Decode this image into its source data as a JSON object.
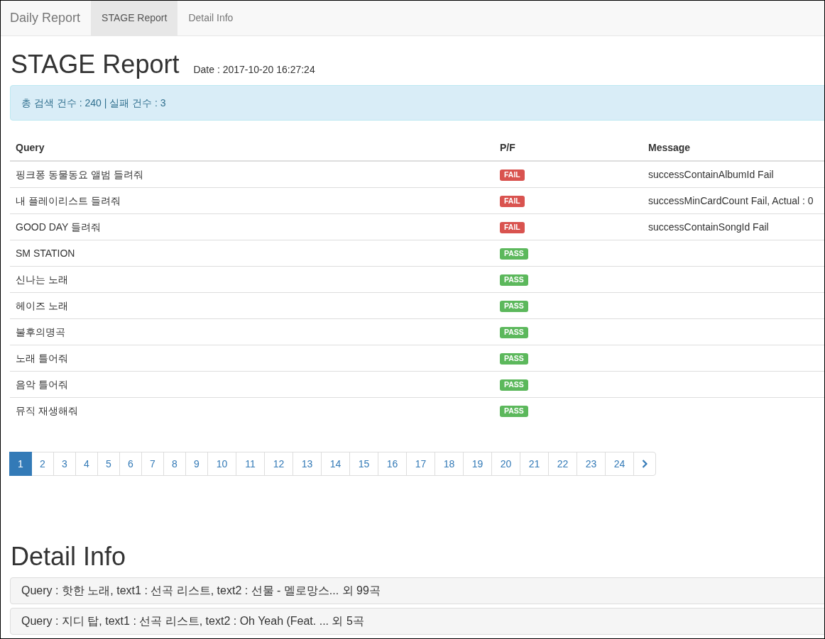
{
  "nav": {
    "brand": "Daily Report",
    "tabs": [
      {
        "label": "STAGE Report",
        "selected": true
      },
      {
        "label": "Detail Info",
        "selected": false
      }
    ]
  },
  "report": {
    "title": "STAGE Report",
    "date": "Date : 2017-10-20 16:27:24",
    "summary": "총 검색 건수 : 240 | 실패 건수 : 3"
  },
  "table": {
    "columns": [
      "Query",
      "P/F",
      "Message"
    ],
    "rows": [
      {
        "query": "핑크퐁 동물동요 앨범 들려줘",
        "kind": "fail",
        "result": "FAIL",
        "message": "successContainAlbumId Fail"
      },
      {
        "query": "내 플레이리스트 들려줘",
        "kind": "fail",
        "result": "FAIL",
        "message": "successMinCardCount Fail, Actual : 0"
      },
      {
        "query": "GOOD DAY 들려줘",
        "kind": "fail",
        "result": "FAIL",
        "message": "successContainSongId Fail"
      },
      {
        "query": "SM STATION",
        "kind": "pass",
        "result": "PASS"
      },
      {
        "query": "신나는 노래",
        "kind": "pass",
        "result": "PASS"
      },
      {
        "query": "헤이즈 노래",
        "kind": "pass",
        "result": "PASS"
      },
      {
        "query": "불후의명곡",
        "kind": "pass",
        "result": "PASS"
      },
      {
        "query": "노래 틀어줘",
        "kind": "pass",
        "result": "PASS"
      },
      {
        "query": "음악 틀어줘",
        "kind": "pass",
        "result": "PASS"
      },
      {
        "query": "뮤직 재생해줘",
        "kind": "pass",
        "result": "PASS"
      }
    ]
  },
  "pagination": {
    "pages": [
      {
        "label": "1",
        "selected": true
      },
      {
        "label": "2",
        "selected": false
      },
      {
        "label": "3",
        "selected": false
      },
      {
        "label": "4",
        "selected": false
      },
      {
        "label": "5",
        "selected": false
      },
      {
        "label": "6",
        "selected": false
      },
      {
        "label": "7",
        "selected": false
      },
      {
        "label": "8",
        "selected": false
      },
      {
        "label": "9",
        "selected": false
      },
      {
        "label": "10",
        "selected": false
      },
      {
        "label": "11",
        "selected": false
      },
      {
        "label": "12",
        "selected": false
      },
      {
        "label": "13",
        "selected": false
      },
      {
        "label": "14",
        "selected": false
      },
      {
        "label": "15",
        "selected": false
      },
      {
        "label": "16",
        "selected": false
      },
      {
        "label": "17",
        "selected": false
      },
      {
        "label": "18",
        "selected": false
      },
      {
        "label": "19",
        "selected": false
      },
      {
        "label": "20",
        "selected": false
      },
      {
        "label": "21",
        "selected": false
      },
      {
        "label": "22",
        "selected": false
      },
      {
        "label": "23",
        "selected": false
      },
      {
        "label": "24",
        "selected": false
      }
    ]
  },
  "detail": {
    "title": "Detail Info",
    "items": [
      "Query : 핫한 노래, text1 : 선곡 리스트, text2 : 선물 - 멜로망스... 외 99곡",
      "Query : 지디 탑, text1 : 선곡 리스트, text2 : Oh Yeah (Feat. ... 외 5곡"
    ]
  }
}
